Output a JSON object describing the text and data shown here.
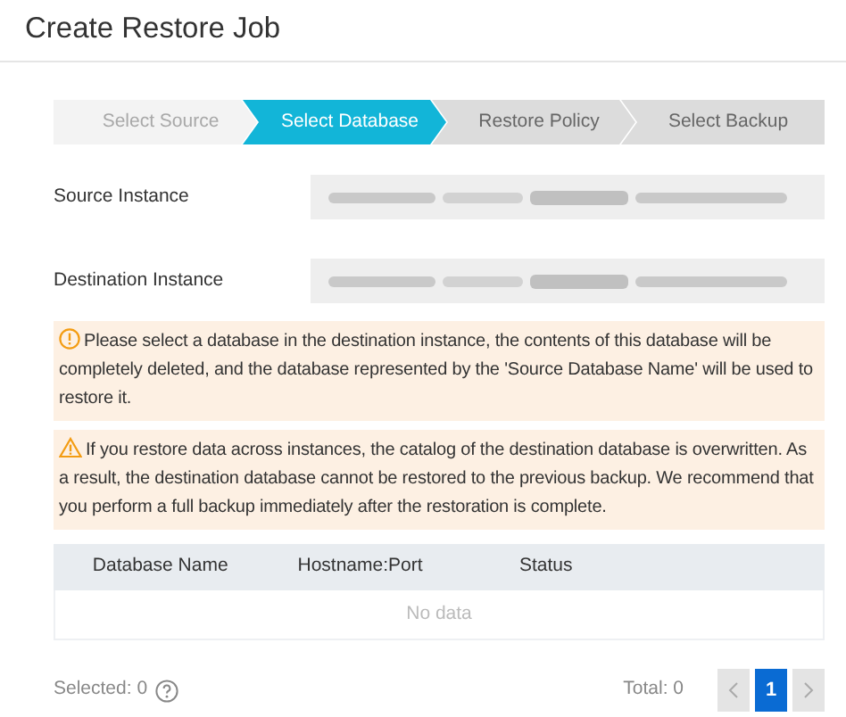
{
  "dialog": {
    "title": "Create Restore Job"
  },
  "steps": [
    {
      "label": "Select Source",
      "completed": true,
      "selected": false
    },
    {
      "label": "Select Database",
      "completed": false,
      "selected": true
    },
    {
      "label": "Restore Policy",
      "completed": false,
      "selected": false
    },
    {
      "label": "Select Backup",
      "completed": false,
      "selected": false
    }
  ],
  "fields": [
    {
      "label": "Source Instance"
    },
    {
      "label": "Destination Instance"
    }
  ],
  "alerts": [
    {
      "kind": "info",
      "text": "Please select a database in the destination instance, the contents of this database will be completely deleted, and the database represented by the 'Source Database Name' will be used to restore it."
    },
    {
      "kind": "warning",
      "text": "If you restore data across instances, the catalog of the destination database is overwritten. As a result, the destination database cannot be restored to the previous backup. We recommend that you perform a full backup immediately after the restoration is complete."
    }
  ],
  "table": {
    "columns": [
      "Database Name",
      "Hostname:Port",
      "Status"
    ],
    "empty_text": "No data"
  },
  "footer": {
    "selected": "Selected: 0",
    "total": "Total: 0",
    "pages": [
      {
        "label": "1",
        "selected": true
      }
    ]
  }
}
